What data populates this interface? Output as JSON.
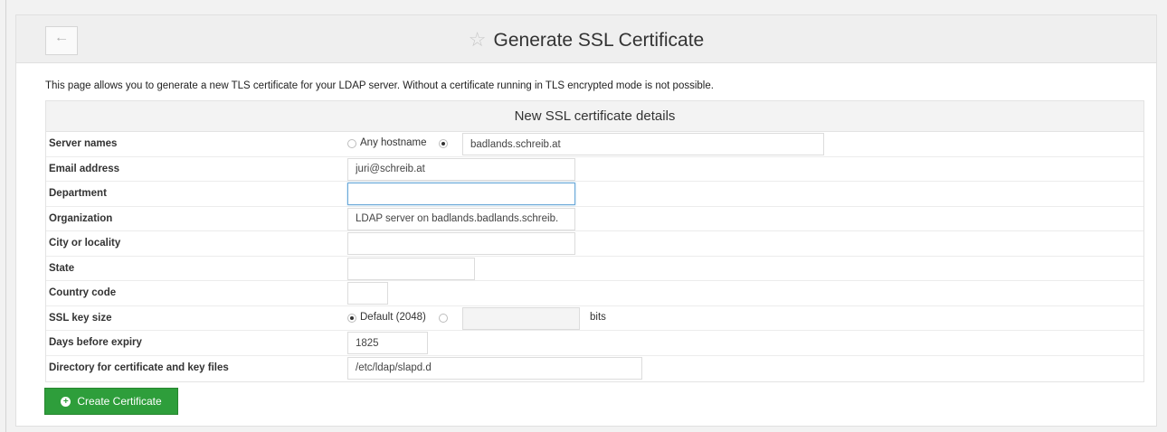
{
  "header": {
    "title": "Generate SSL Certificate",
    "back_icon": "arrow-left-icon",
    "star_icon": "star-outline-icon"
  },
  "intro": "This page allows you to generate a new TLS certificate for your LDAP server. Without a certificate running in TLS encrypted mode is not possible.",
  "details": {
    "heading": "New SSL certificate details",
    "server_names": {
      "label": "Server names",
      "any_label": "Any hostname",
      "value": "badlands.schreib.at",
      "selected": "custom"
    },
    "email": {
      "label": "Email address",
      "value": "juri@schreib.at"
    },
    "department": {
      "label": "Department",
      "value": ""
    },
    "organization": {
      "label": "Organization",
      "value": "LDAP server on badlands.badlands.schreib."
    },
    "city": {
      "label": "City or locality",
      "value": ""
    },
    "state": {
      "label": "State",
      "value": ""
    },
    "country": {
      "label": "Country code",
      "value": ""
    },
    "key_size": {
      "label": "SSL key size",
      "default_label": "Default (2048)",
      "custom_value": "",
      "unit": "bits",
      "selected": "default"
    },
    "days": {
      "label": "Days before expiry",
      "value": "1825"
    },
    "directory": {
      "label": "Directory for certificate and key files",
      "value": "/etc/ldap/slapd.d"
    }
  },
  "create_button": {
    "label": "Create Certificate",
    "icon": "plus-circle-icon",
    "color": "#2e9e3b"
  }
}
